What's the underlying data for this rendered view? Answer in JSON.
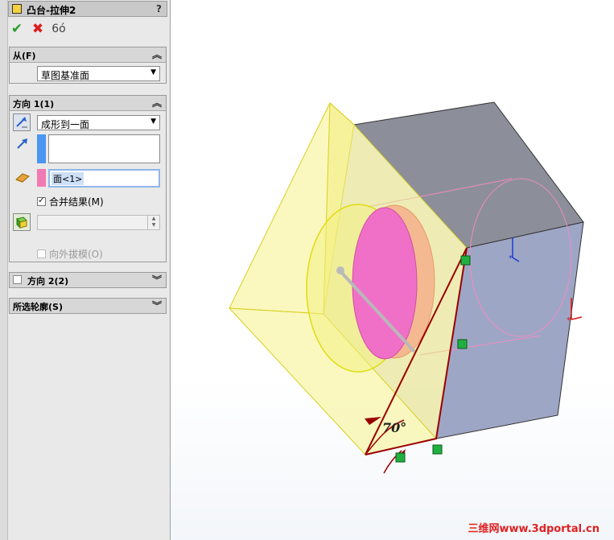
{
  "feature": {
    "title": "凸台-拉伸2",
    "help": "?"
  },
  "actions": {
    "ok_icon": "✔",
    "cancel_icon": "✖",
    "preview_icon": "6ó"
  },
  "from": {
    "header": "从(F)",
    "start_condition": "草图基准面"
  },
  "direction1": {
    "header": "方向 1(1)",
    "end_condition": "成形到一面",
    "face_selection": "面<1>",
    "merge_result": {
      "label": "合并结果(M)",
      "checked": true
    },
    "draft_outward": {
      "label": "向外拔模(O)",
      "checked": false
    }
  },
  "direction2": {
    "header": "方向 2(2)",
    "checked": false
  },
  "selected_contours": {
    "header": "所选轮廓(S)"
  },
  "viewport": {
    "angle_label": "70°",
    "watermark": "三维网www.3dportal.cn"
  },
  "colors": {
    "accent_blue": "#4a96f0",
    "selection_pink": "#f07ab4",
    "preview_yellow": "#f5f28a",
    "block_top": "#8c8f99",
    "block_side": "#9ea6c6",
    "edge_red": "#9a0000"
  }
}
